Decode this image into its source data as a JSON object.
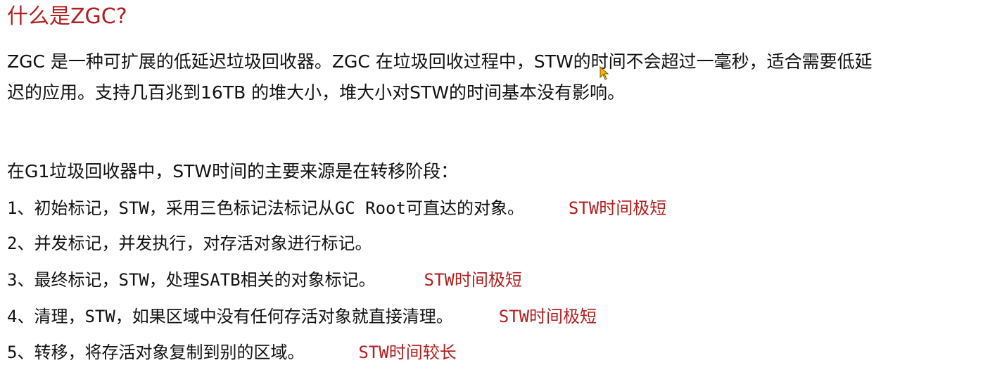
{
  "title": "什么是ZGC?",
  "intro": {
    "line1": "ZGC 是一种可扩展的低延迟垃圾回收器。ZGC 在垃圾回收过程中，STW的时间不会超过一毫秒，适合需要低延",
    "line2": "迟的应用。支持几百兆到16TB 的堆大小，堆大小对STW的时间基本没有影响。"
  },
  "section_heading": "在G1垃圾回收器中，STW时间的主要来源是在转移阶段：",
  "steps": [
    {
      "text": "1、初始标记，STW，采用三色标记法标记从GC Root可直达的对象。",
      "note": "STW时间极短"
    },
    {
      "text": "2、并发标记，并发执行，对存活对象进行标记。",
      "note": ""
    },
    {
      "text": "3、最终标记，STW，处理SATB相关的对象标记。",
      "note": "STW时间极短"
    },
    {
      "text": "4、清理，STW，如果区域中没有任何存活对象就直接清理。",
      "note": "STW时间极短"
    },
    {
      "text": "5、转移，将存活对象复制到别的区域。",
      "note": "STW时间较长"
    }
  ],
  "colors": {
    "accent_red": "#b21f1f",
    "text": "#111111",
    "cursor_fill": "#f5b400"
  },
  "icons": {
    "cursor": "mouse-pointer-icon"
  }
}
